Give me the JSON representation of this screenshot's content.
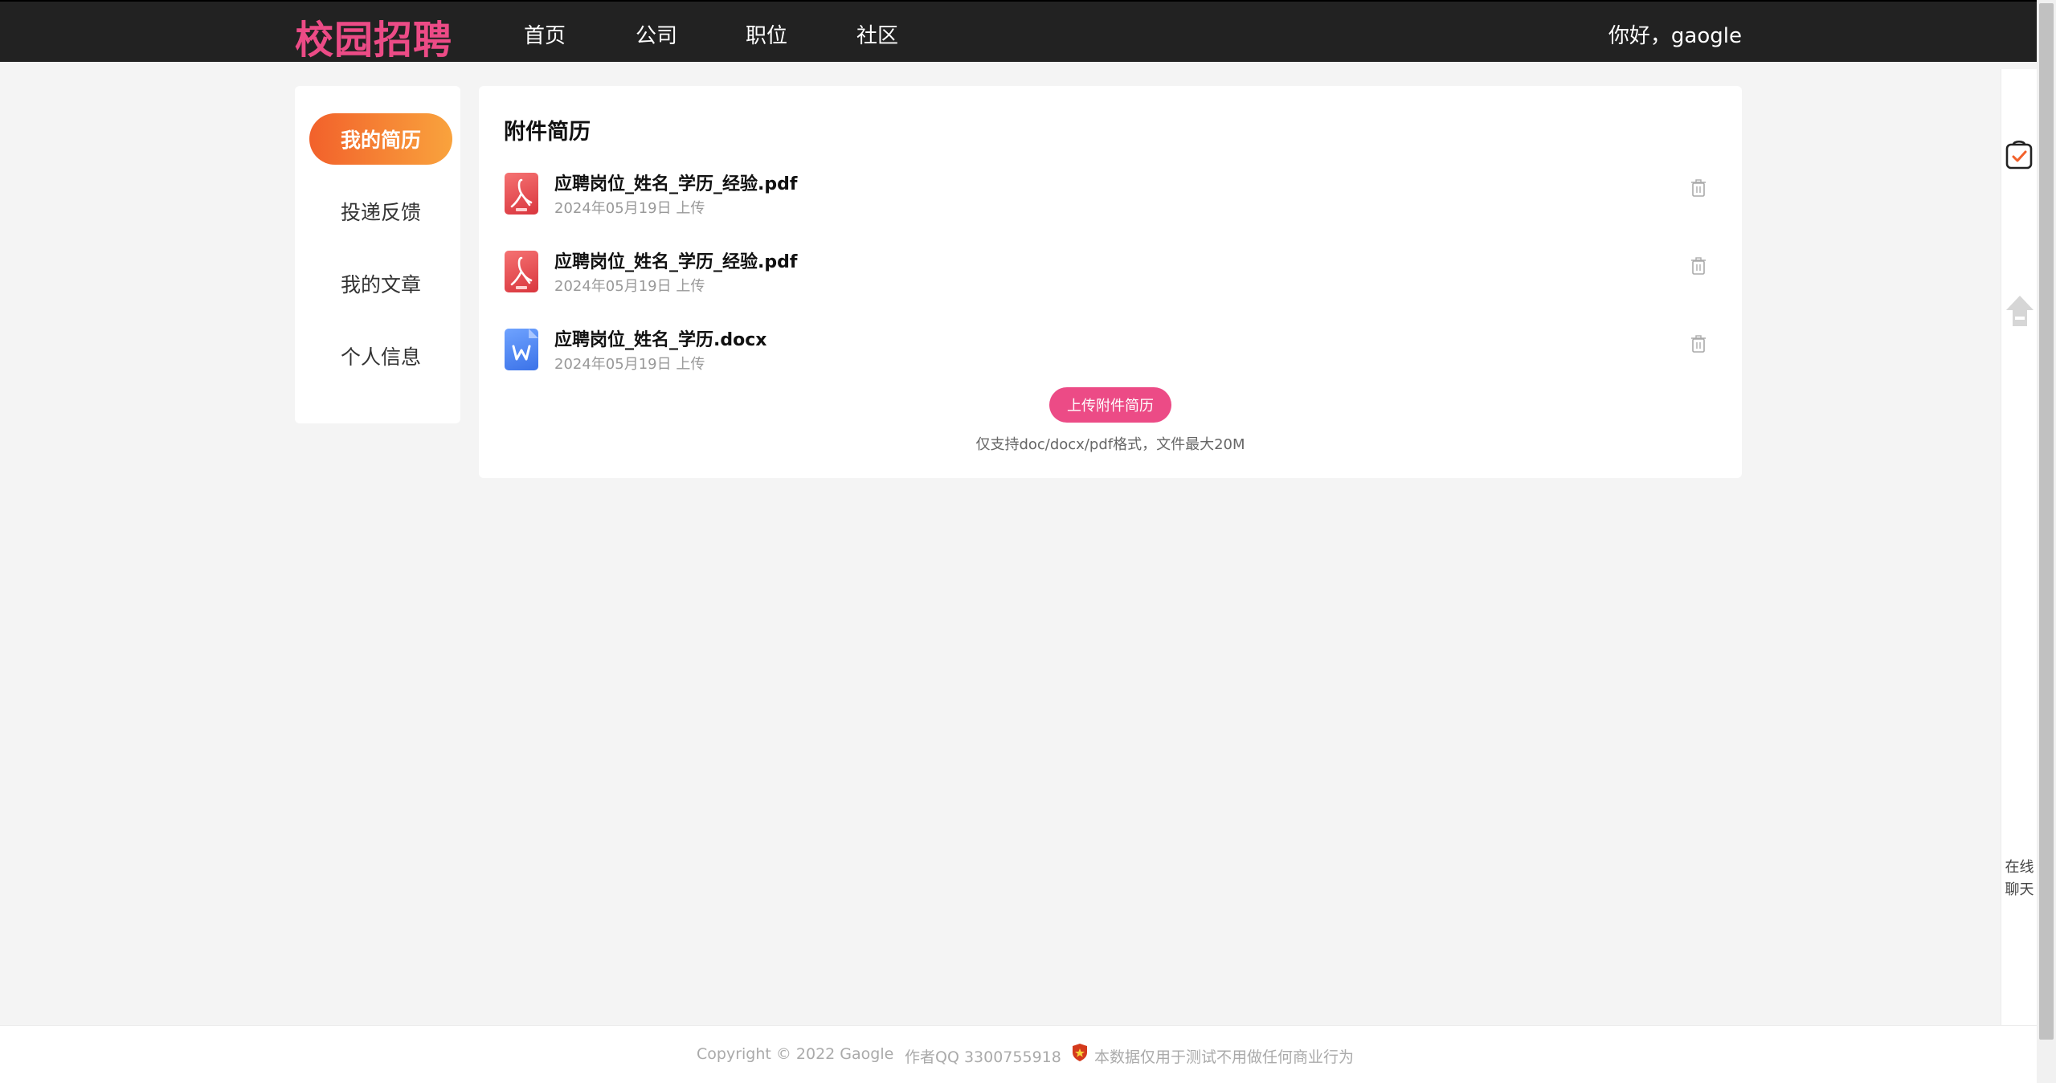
{
  "header": {
    "logo": "校园招聘",
    "nav": [
      "首页",
      "公司",
      "职位",
      "社区"
    ],
    "greeting": "你好，gaogle"
  },
  "sidebar": {
    "items": [
      {
        "label": "我的简历",
        "active": true
      },
      {
        "label": "投递反馈",
        "active": false
      },
      {
        "label": "我的文章",
        "active": false
      },
      {
        "label": "个人信息",
        "active": false
      }
    ]
  },
  "main": {
    "title": "附件简历",
    "files": [
      {
        "name": "应聘岗位_姓名_学历_经验.pdf",
        "date": "2024年05月19日 上传",
        "type": "pdf",
        "icon": "pdf-file-icon"
      },
      {
        "name": "应聘岗位_姓名_学历_经验.pdf",
        "date": "2024年05月19日 上传",
        "type": "pdf",
        "icon": "pdf-file-icon"
      },
      {
        "name": "应聘岗位_姓名_学历.docx",
        "date": "2024年05月19日 上传",
        "type": "docx",
        "icon": "word-file-icon"
      }
    ],
    "upload_label": "上传附件简历",
    "upload_hint": "仅支持doc/docx/pdf格式，文件最大20M"
  },
  "right_panel": {
    "chat_line1": "在线",
    "chat_line2": "聊天"
  },
  "footer": {
    "copyright": "Copyright © 2022 Gaogle",
    "author": "作者QQ 3300755918",
    "notice": "本数据仅用于测试不用做任何商业行为"
  },
  "colors": {
    "brand": "#ec4b86",
    "header_bg": "#222222",
    "sidebar_active_start": "#f2612b",
    "sidebar_active_end": "#f9a33d"
  }
}
